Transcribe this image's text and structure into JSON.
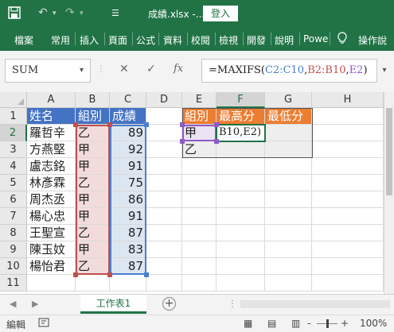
{
  "titlebar": {
    "filename": "成績.xlsx  -...",
    "login_label": "登入"
  },
  "ribbon": {
    "tabs": [
      "檔案",
      "常用",
      "插入",
      "頁面",
      "公式",
      "資料",
      "校閱",
      "檢視",
      "開發",
      "說明",
      "Powe",
      "操作說"
    ]
  },
  "formula_bar": {
    "name_box": "SUM",
    "formula_prefix": "=MAXIFS(",
    "formula_range1": "C2:C10",
    "formula_sep1": ",",
    "formula_range2": "B2:B10",
    "formula_sep2": ",",
    "formula_range3": "E2",
    "formula_suffix": ")"
  },
  "columns": [
    "A",
    "B",
    "C",
    "D",
    "E",
    "F",
    "G",
    "H"
  ],
  "rows": [
    "1",
    "2",
    "3",
    "4",
    "5",
    "6",
    "7",
    "8",
    "9",
    "10",
    "11"
  ],
  "headers": {
    "a1": "姓名",
    "b1": "組別",
    "c1": "成績",
    "e1": "組別",
    "f1": "最高分",
    "g1": "最低分"
  },
  "students": [
    {
      "name": "羅哲辛",
      "group": "乙",
      "score": "89"
    },
    {
      "name": "方燕堅",
      "group": "甲",
      "score": "92"
    },
    {
      "name": "盧志銘",
      "group": "甲",
      "score": "91"
    },
    {
      "name": "林彥霖",
      "group": "乙",
      "score": "75"
    },
    {
      "name": "周杰丞",
      "group": "甲",
      "score": "86"
    },
    {
      "name": "楊心忠",
      "group": "甲",
      "score": "91"
    },
    {
      "name": "王聖宣",
      "group": "乙",
      "score": "87"
    },
    {
      "name": "陳玉妏",
      "group": "甲",
      "score": "83"
    },
    {
      "name": "楊怡君",
      "group": "乙",
      "score": "87"
    }
  ],
  "summary": {
    "e2": "甲",
    "f2": "B10,E2)",
    "e3": "乙"
  },
  "sheet": {
    "tab_label": "工作表1",
    "add_label": "+"
  },
  "status": {
    "mode": "編輯",
    "zoom": "100%",
    "zoom_minus": "-",
    "zoom_plus": "+"
  },
  "colors": {
    "excel_green": "#217346",
    "header_blue": "#4472c4",
    "header_orange": "#ed7d31",
    "range_blue": "#4a7fd0",
    "range_red": "#c0504d",
    "range_purple": "#8e5ac8"
  }
}
